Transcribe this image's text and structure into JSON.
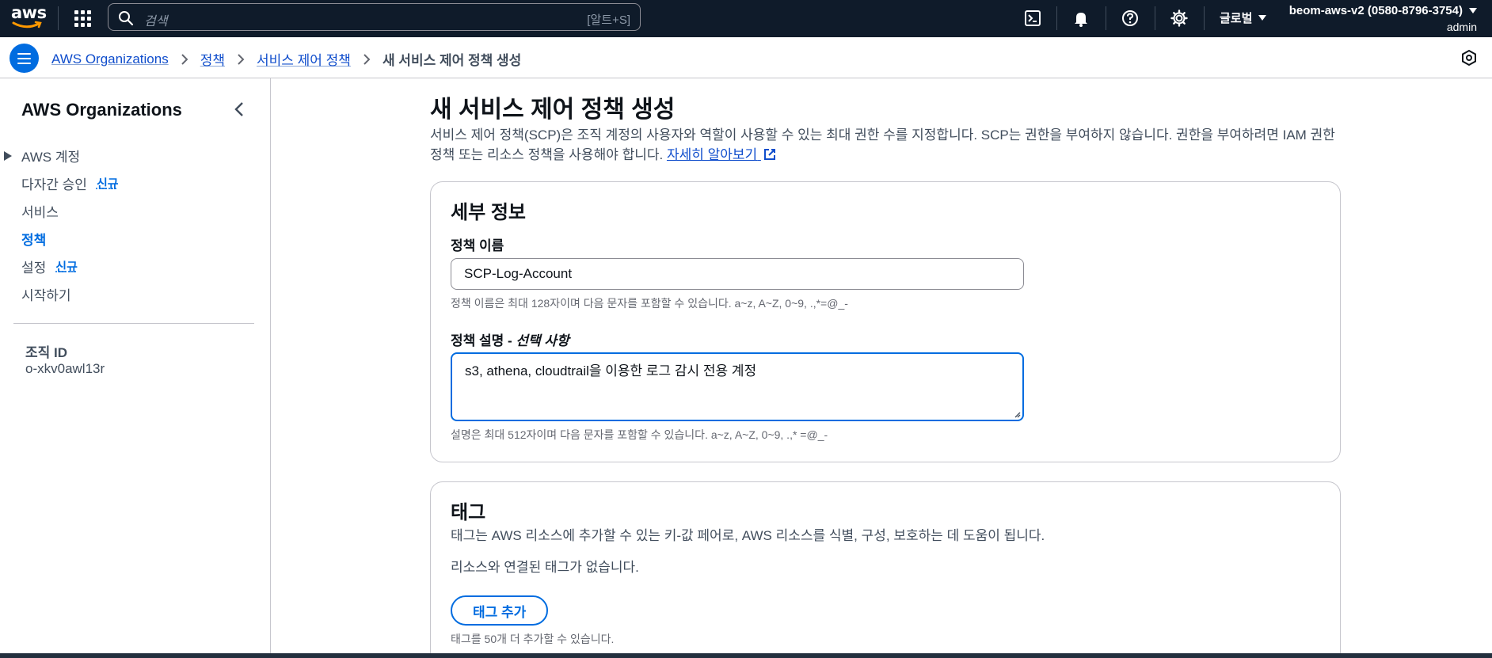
{
  "topnav": {
    "logo_text": "aws",
    "search_placeholder": "검색",
    "search_shortcut": "[알트+S]",
    "region_label": "글로벌",
    "account_name": "beom-aws-v2 (0580-8796-3754)",
    "account_user": "admin",
    "icons": [
      "cloudshell-icon",
      "notifications-icon",
      "help-icon",
      "settings-icon"
    ]
  },
  "breadcrumb": {
    "items": [
      "AWS Organizations",
      "정책",
      "서비스 제어 정책"
    ],
    "current": "새 서비스 제어 정책 생성"
  },
  "sidenav": {
    "title": "AWS Organizations",
    "items": [
      {
        "label": "AWS 계정",
        "badge": ""
      },
      {
        "label": "다자간 승인",
        "badge": "신규"
      },
      {
        "label": "서비스",
        "badge": ""
      },
      {
        "label": "정책",
        "badge": ""
      },
      {
        "label": "설정",
        "badge": "신규"
      },
      {
        "label": "시작하기",
        "badge": ""
      }
    ],
    "org_id_label": "조직 ID",
    "org_id_value": "o-xkv0awl13r"
  },
  "page": {
    "title": "새 서비스 제어 정책 생성",
    "description": "서비스 제어 정책(SCP)은 조직 계정의 사용자와 역할이 사용할 수 있는 최대 권한 수를 지정합니다. SCP는 권한을 부여하지 않습니다. 권한을 부여하려면 IAM 권한 정책 또는 리소스 정책을 사용해야 합니다.",
    "learn_more": "자세히 알아보기"
  },
  "details": {
    "header": "세부 정보",
    "name_label": "정책 이름",
    "name_value": "SCP-Log-Account",
    "name_hint": "정책 이름은 최대 128자이며 다음 문자를 포함할 수 있습니다. a~z, A~Z, 0~9, .,*=@_-",
    "desc_label": "정책 설명 - ",
    "desc_label_optional": "선택 사항",
    "desc_value": "s3, athena, cloudtrail을 이용한 로그 감시 전용 계정",
    "desc_hint": "설명은 최대 512자이며 다음 문자를 포함할 수 있습니다. a~z, A~Z, 0~9, .,* =@_-"
  },
  "tags": {
    "header": "태그",
    "description": "태그는 AWS 리소스에 추가할 수 있는 키-값 페어로, AWS 리소스를 식별, 구성, 보호하는 데 도움이 됩니다.",
    "empty": "리소스와 연결된 태그가 없습니다.",
    "add_button": "태그 추가",
    "limit_hint": "태그를 50개 더 추가할 수 있습니다."
  },
  "colors": {
    "nav_bg": "#0f1b2a",
    "accent": "#006ce0",
    "link": "#0f4dcc",
    "border": "#c6c6cd"
  }
}
